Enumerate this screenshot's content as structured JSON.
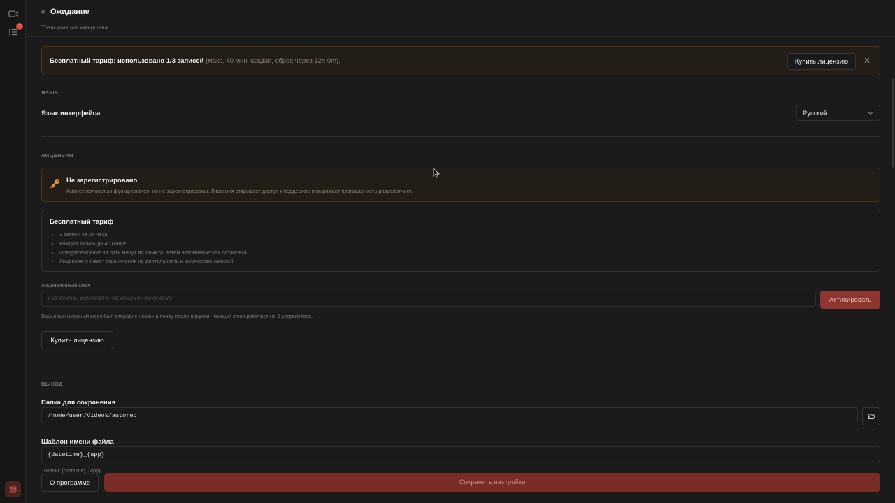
{
  "rail": {
    "badge_count": "2"
  },
  "header": {
    "status": "Ожидание",
    "subtitle": "Транскрипция завершена"
  },
  "banner": {
    "strong": "Бесплатный тариф: использовано 1/3 записей",
    "muted": " (макс. 40 мин каждая, сброс через 12h 0m).",
    "buy_label": "Купить лицензию",
    "close_glyph": "✕"
  },
  "language": {
    "section": "ЯЗЫК",
    "label": "Язык интерфейса",
    "selected": "Русский"
  },
  "license": {
    "section": "ЛИЦЕНЗИЯ",
    "notice_title": "Не зарегистрировано",
    "notice_text": "Autorec полностью функционален, но не зарегистрирован. Лицензия открывает доступ к поддержке и выражает благодарность разработчику.",
    "tier_title": "Бесплатный тариф",
    "tier_items": [
      "3 записи за 24 часа",
      "Каждая запись до 40 минут",
      "Предупреждение за пять минут до лимита, затем автоматическая остановка",
      "Лицензия снимает ограничения на длительность и количество записей"
    ],
    "key_label": "Лицензионный ключ",
    "key_placeholder": "XXXXXXXX-XXXXXXXX-XXXXXXXX-XXXXXXXX",
    "activate_label": "Активировать",
    "key_hint": "Ваш лицензионный ключ был отправлен вам на почту после покупки. Каждый ключ работает на 5 устройствах.",
    "buy_label": "Купить лицензию"
  },
  "output": {
    "section": "ВЫХОД",
    "folder_label": "Папка для сохранения",
    "folder_value": "/home/user/Videos/autorec",
    "template_label": "Шаблон имени файла",
    "template_value": "{datetime}_{app}",
    "tokens_hint": "Токены: {datetime}, {app}"
  },
  "footer": {
    "about_label": "О программе",
    "save_label": "Сохранить настройки"
  }
}
